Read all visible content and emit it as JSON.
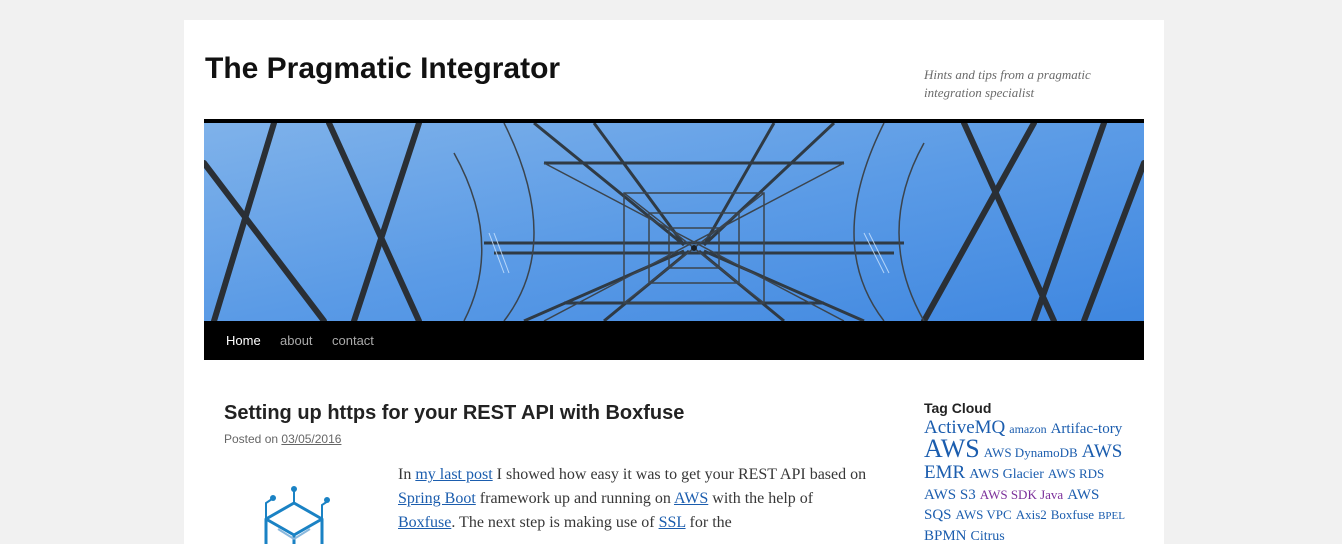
{
  "site": {
    "title": "The Pragmatic Integrator",
    "tagline_line1": "Hints and tips from a pragmatic",
    "tagline_line2": "integration specialist"
  },
  "nav": {
    "items": [
      {
        "label": "Home",
        "active": true
      },
      {
        "label": "about"
      },
      {
        "label": "contact"
      }
    ]
  },
  "post": {
    "title": "Setting up https for your REST API with Boxfuse",
    "posted_on_label": "Posted on",
    "date": "03/05/2016",
    "body": {
      "t1": "In ",
      "link1": "my last post",
      "t2": " I showed how easy it was to get your REST API based on ",
      "link2": "Spring Boot",
      "t3": " framework up and running on ",
      "link3": "AWS",
      "t4": " with the help of ",
      "link4": "Boxfuse",
      "t5": ". The next step is making use of ",
      "link5": "SSL",
      "t6": " for the"
    }
  },
  "sidebar": {
    "tag_cloud_title": "Tag Cloud",
    "tags": {
      "t0": "ActiveMQ",
      "t1": "amazon",
      "t2": "Artifac-tory",
      "t3": "AWS",
      "t4": "AWS DynamoDB",
      "t5": "AWS EMR",
      "t6": "AWS Glacier",
      "t7": "AWS RDS",
      "t8": "AWS S3",
      "t9": "AWS SDK Java",
      "t10": "AWS SQS",
      "t11": "AWS VPC",
      "t12": "Axis2",
      "t13": "Boxfuse",
      "t14": "BPEL",
      "t15": "BPMN",
      "t16": "Citrus"
    }
  },
  "colors": {
    "link": "#1b5dae",
    "visited_link": "#7b2f9a",
    "nav_background": "#000000",
    "page_background": "#f1f1f1",
    "banner_sky": "#4a8ee6"
  },
  "icons": {
    "post_logo": "boxfuse-logo",
    "banner": "pylon-photo"
  }
}
